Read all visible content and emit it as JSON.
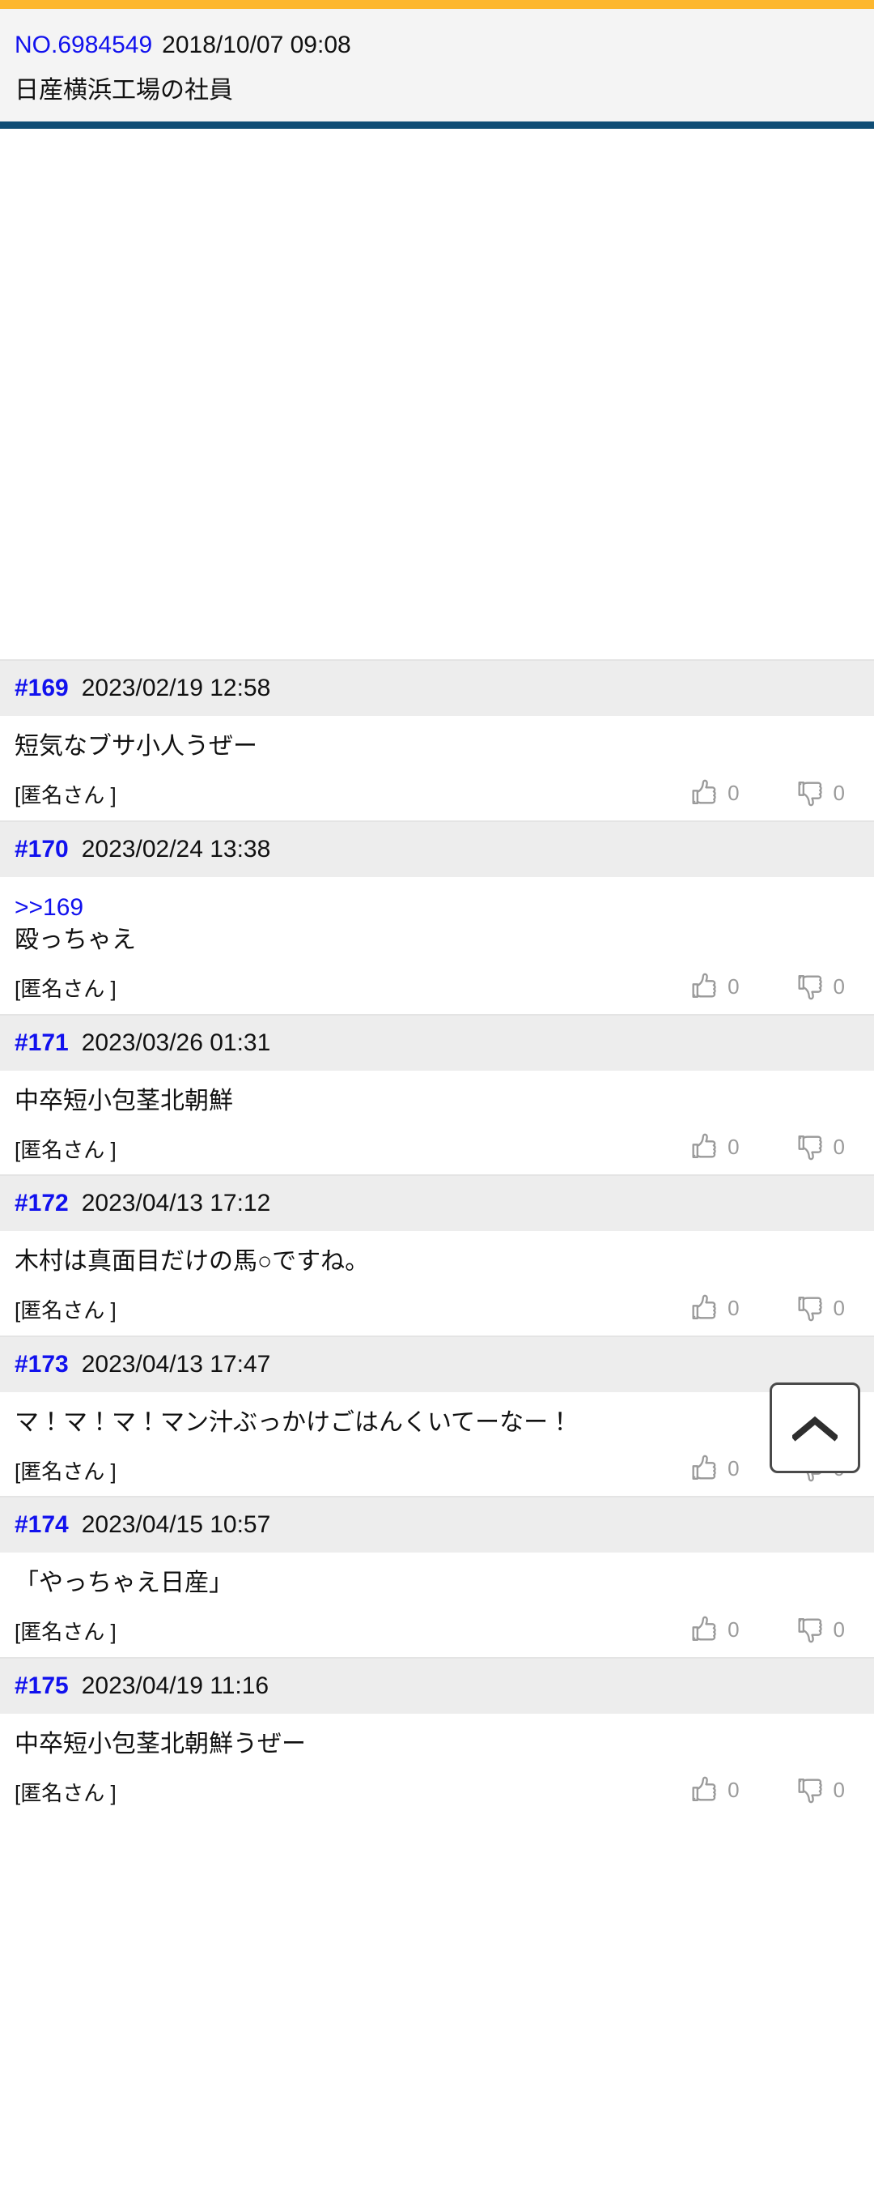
{
  "theme": {
    "accent_bar_color": "#fdb72e",
    "divider_color": "#104d75",
    "link_color": "#1111ee",
    "post_head_bg": "#ededed",
    "reaction_color": "#9a9a9a"
  },
  "thread": {
    "number_label": "NO.6984549",
    "posted_at": "2018/10/07 09:08",
    "title": "日産横浜工場の社員"
  },
  "scroll_top_button": {
    "icon": "chevron-up-icon",
    "label": "^"
  },
  "reaction_icons": {
    "like": "thumbs-up-icon",
    "dislike": "thumbs-down-icon"
  },
  "posts": [
    {
      "number": "#169",
      "date": "2023/02/19 12:58",
      "quote": "",
      "text": "短気なブサ小人うぜー",
      "author": "[匿名さん ]",
      "likes": "0",
      "dislikes": "0"
    },
    {
      "number": "#170",
      "date": "2023/02/24 13:38",
      "quote": ">>169",
      "text": "殴っちゃえ",
      "author": "[匿名さん ]",
      "likes": "0",
      "dislikes": "0"
    },
    {
      "number": "#171",
      "date": "2023/03/26 01:31",
      "quote": "",
      "text": "中卒短小包茎北朝鮮",
      "author": "[匿名さん ]",
      "likes": "0",
      "dislikes": "0"
    },
    {
      "number": "#172",
      "date": "2023/04/13 17:12",
      "quote": "",
      "text": "木村は真面目だけの馬○ですね。",
      "author": "[匿名さん ]",
      "likes": "0",
      "dislikes": "0"
    },
    {
      "number": "#173",
      "date": "2023/04/13 17:47",
      "quote": "",
      "text": "マ！マ！マ！マン汁ぶっかけごはんくいてーなー！",
      "author": "[匿名さん ]",
      "likes": "0",
      "dislikes": "0"
    },
    {
      "number": "#174",
      "date": "2023/04/15 10:57",
      "quote": "",
      "text": "「やっちゃえ日産」",
      "author": "[匿名さん ]",
      "likes": "0",
      "dislikes": "0"
    },
    {
      "number": "#175",
      "date": "2023/04/19 11:16",
      "quote": "",
      "text": "中卒短小包茎北朝鮮うぜー",
      "author": "[匿名さん ]",
      "likes": "0",
      "dislikes": "0"
    }
  ]
}
